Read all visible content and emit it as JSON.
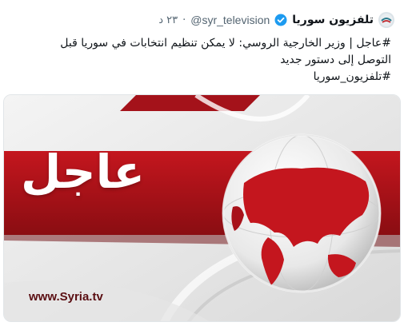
{
  "header": {
    "display_name": "تلفزيون سوريا",
    "handle": "@syr_television",
    "separator": "·",
    "time": "٢٣ د",
    "avatar_icon": "syria-tv-logo-icon",
    "verified_icon": "verified-badge-icon"
  },
  "tweet": {
    "line1": "#عاجل | وزير الخارجية الروسي: لا يمكن تنظيم انتخابات في سوريا قبل",
    "line2": "التوصل إلى دستور جديد",
    "line3": "#تلفزيون_سوريا"
  },
  "media": {
    "banner_label": "عاجل",
    "site_url": "www.Syria.tv",
    "globe_icon": "globe-icon"
  },
  "colors": {
    "accent_red": "#b5141c",
    "dark_red": "#7a0c10",
    "text": "#0f1419",
    "muted": "#536471",
    "verified": "#1d9bf0"
  }
}
